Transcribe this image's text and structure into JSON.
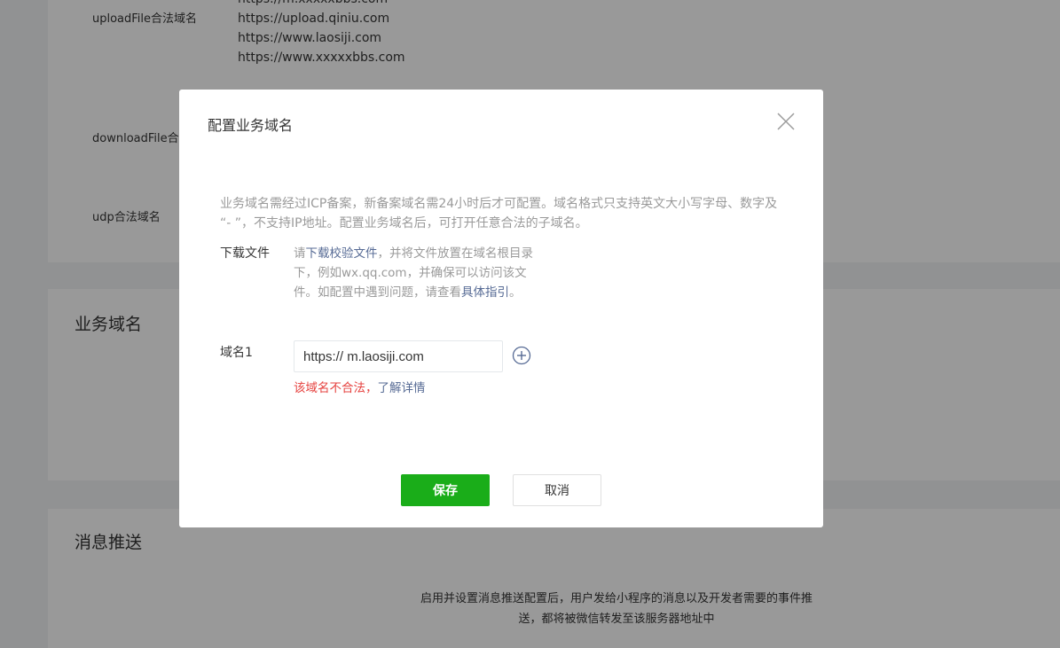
{
  "background": {
    "server_domains": {
      "upload_label": "uploadFile合法域名",
      "upload_domains": [
        "https://m.xxxxxbbs.com",
        "https://upload.qiniu.com",
        "https://www.laosiji.com",
        "https://www.xxxxxbbs.com"
      ],
      "download_label": "downloadFile合法域名",
      "udp_label": "udp合法域名"
    },
    "business_domain_title": "业务域名",
    "message_push_title": "消息推送",
    "message_push_desc_line1": "启用并设置消息推送配置后，用户发给小程序的消息以及开发者需要的事件推",
    "message_push_desc_line2": "送，都将被微信转发至该服务器地址中"
  },
  "dialog": {
    "title": "配置业务域名",
    "close_icon": "close-icon",
    "intro_line1": "业务域名需经过ICP备案，新备案域名需24小时后才可配置。域名格式只支持英文大小写字母、数字及",
    "intro_line2": "“- ”，不支持IP地址。配置业务域名后，可打开任意合法的子域名。",
    "download": {
      "label": "下载文件",
      "desc_prefix": "请",
      "desc_link": "下载校验文件",
      "desc_middle": "，并将文件放置在域名根目录下，例如wx.qq.com，并确保可以访问该文件。如配置中遇到问题，请查看",
      "desc_link2": "具体指引",
      "desc_suffix": "。"
    },
    "domain_field": {
      "label": "域名1",
      "value": "https:// m.laosiji.com",
      "add_icon": "plus-circle-icon",
      "error_text": "该域名不合法，",
      "error_link": "了解详情"
    },
    "save_label": "保存",
    "cancel_label": "取消"
  },
  "colors": {
    "primary": "#1aad19",
    "link": "#576b95",
    "error": "#e64340",
    "overlay": "rgba(0,0,0,0.40)"
  }
}
